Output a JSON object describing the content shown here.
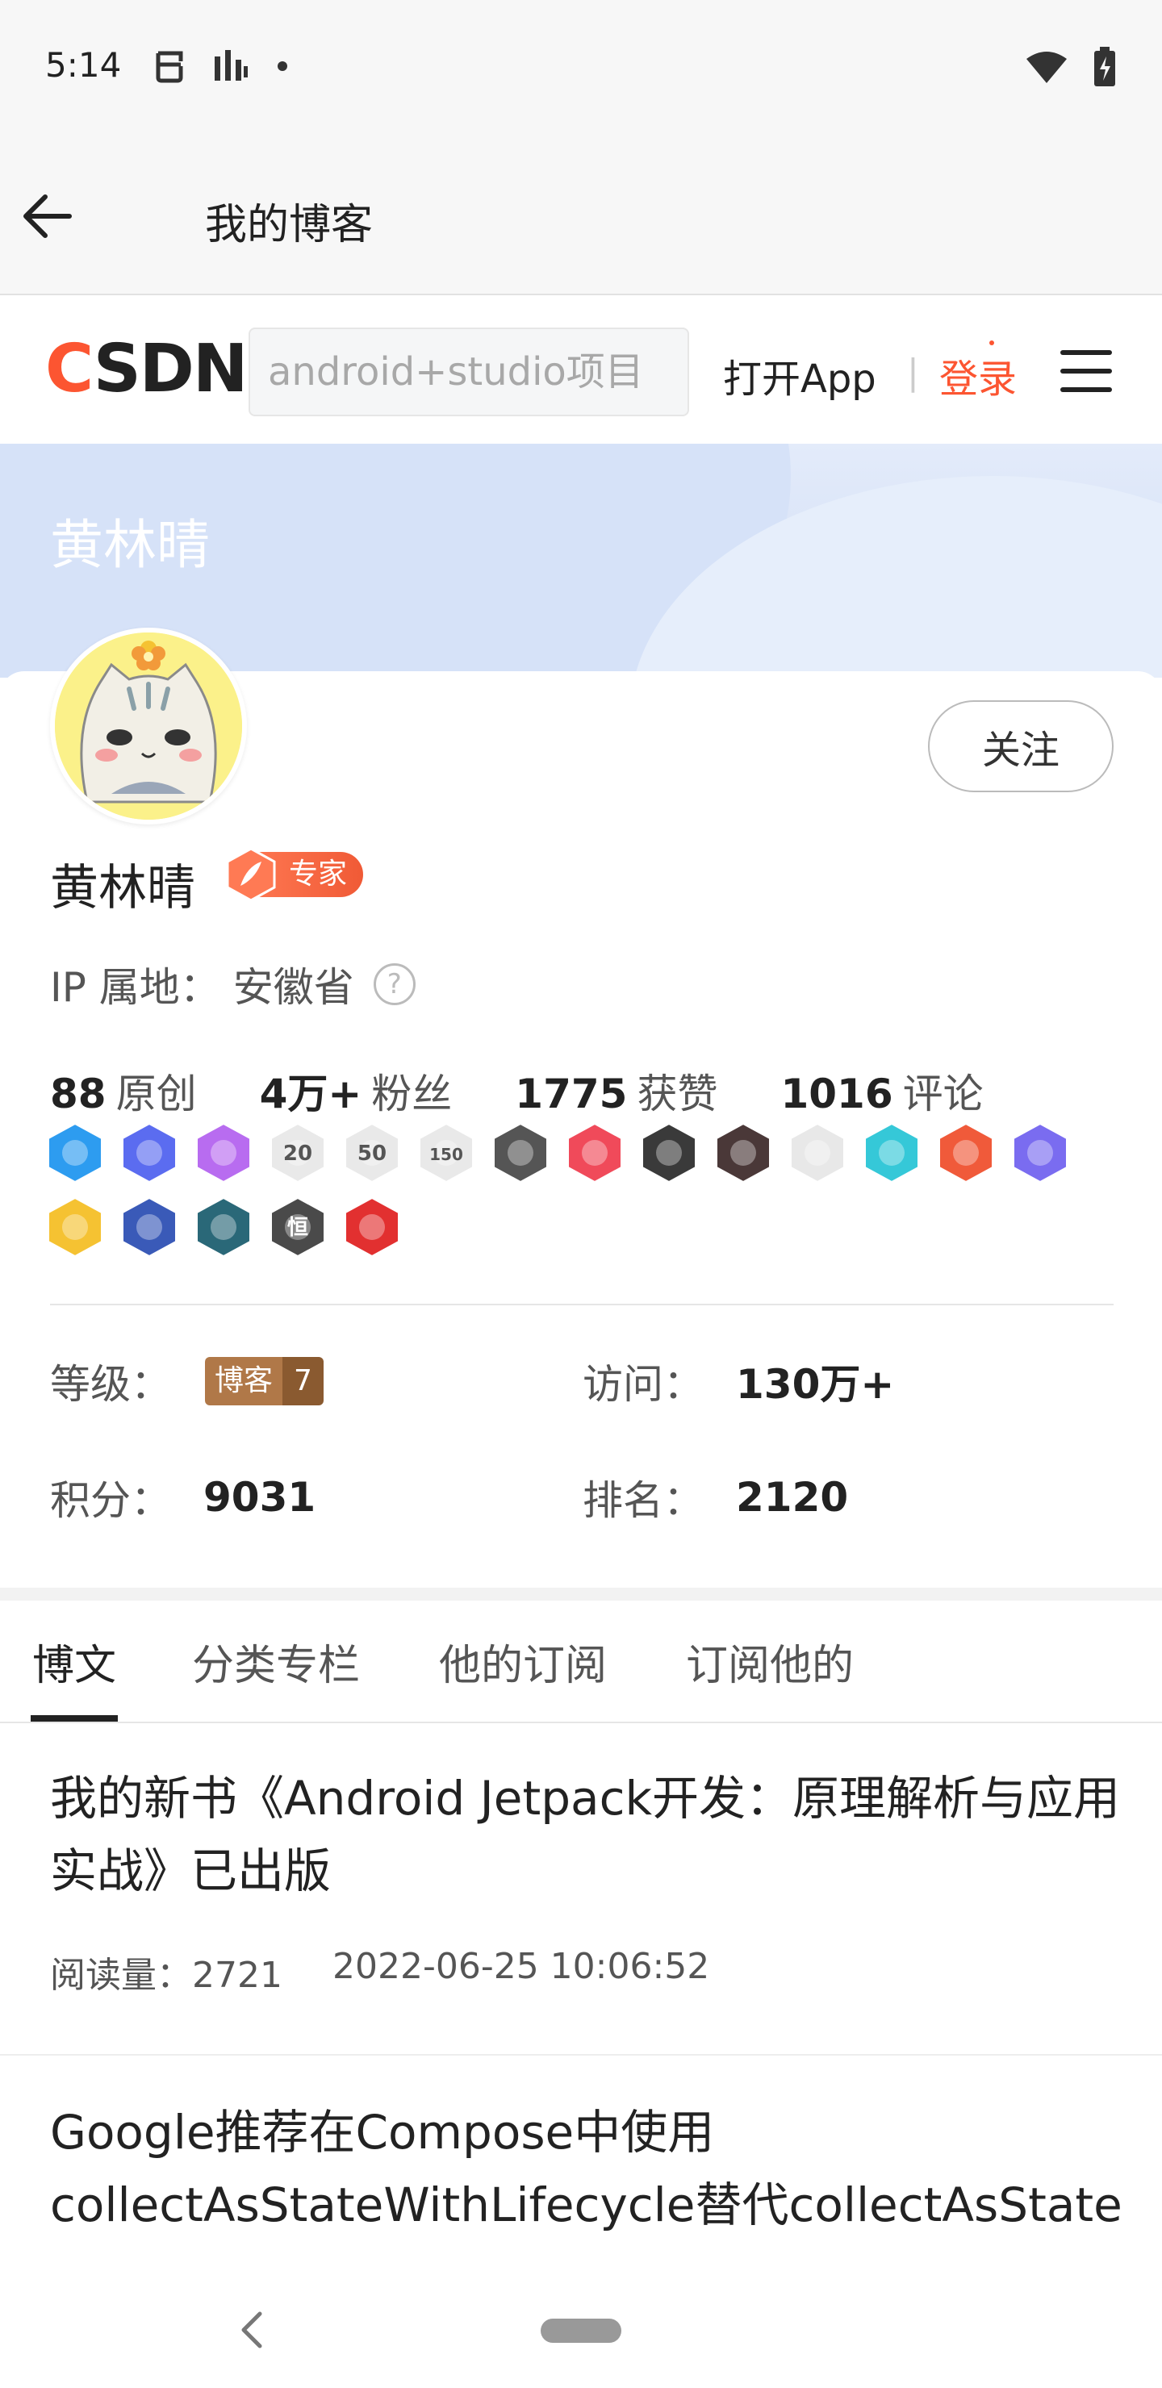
{
  "status_bar": {
    "time": "5:14",
    "left_icons": [
      "face-icon",
      "signal-bars-icon",
      "dot-icon"
    ],
    "right_icons": [
      "wifi-icon",
      "battery-charging-icon"
    ]
  },
  "app_bar": {
    "title": "我的博客",
    "back_icon": "arrow-left-icon"
  },
  "csdn_header": {
    "logo_c": "C",
    "logo_rest": "SDN",
    "search_placeholder": "android+studio项目",
    "open_app": "打开App",
    "separator": "|",
    "login": "登录",
    "menu_icon": "hamburger-menu-icon",
    "brand_color": "#fc5531"
  },
  "banner": {
    "name": "黄林晴"
  },
  "profile": {
    "follow_label": "关注",
    "name": "黄林晴",
    "expert_label": "专家",
    "ip_label": "IP 属地：",
    "ip_value": "安徽省",
    "help_glyph": "?",
    "stats": [
      {
        "num": "88",
        "label": "原创"
      },
      {
        "num": "4万+",
        "label": "粉丝"
      },
      {
        "num": "1775",
        "label": "获赞"
      },
      {
        "num": "1016",
        "label": "评论"
      }
    ],
    "badges": [
      {
        "icon": "star-badge-icon",
        "color": "#2d9cf0",
        "text": ""
      },
      {
        "icon": "planet-badge-icon",
        "color": "#5b6cf0",
        "text": ""
      },
      {
        "icon": "planet-orange-badge-icon",
        "color": "#b86cf0",
        "text": ""
      },
      {
        "icon": "days-20-badge-icon",
        "color": "#e9e9e9",
        "text": "20"
      },
      {
        "icon": "days-50-badge-icon",
        "color": "#e9e9e9",
        "text": "50"
      },
      {
        "icon": "days-150-badge-icon",
        "color": "#e9e9e9",
        "text": "150"
      },
      {
        "icon": "github-badge-icon",
        "color": "#555555",
        "text": ""
      },
      {
        "icon": "pen-red-badge-icon",
        "color": "#f04a5a",
        "text": ""
      },
      {
        "icon": "medal-1024-badge-icon",
        "color": "#3a3a3a",
        "text": ""
      },
      {
        "icon": "year-2020-badge-icon",
        "color": "#4a3838",
        "text": ""
      },
      {
        "icon": "monkey-badge-icon",
        "color": "#e8e8e8",
        "text": ""
      },
      {
        "icon": "chat-cyan-badge-icon",
        "color": "#35c8d8",
        "text": ""
      },
      {
        "icon": "gift-red-badge-icon",
        "color": "#f05a3a",
        "text": ""
      },
      {
        "icon": "hand-purple-badge-icon",
        "color": "#7a6cf0",
        "text": ""
      },
      {
        "icon": "check-yellow-badge-icon",
        "color": "#f5c232",
        "text": ""
      },
      {
        "icon": "rocket-blue-badge-icon",
        "color": "#3a5ab8",
        "text": ""
      },
      {
        "icon": "list-teal-badge-icon",
        "color": "#2a6878",
        "text": ""
      },
      {
        "icon": "heng-gray-badge-icon",
        "color": "#4a4a4a",
        "text": "恒"
      },
      {
        "icon": "pen-crimson-badge-icon",
        "color": "#e23030",
        "text": ""
      }
    ],
    "level_label": "等级：",
    "level_badge_text": "博客",
    "level_badge_num": "7",
    "visits_label": "访问：",
    "visits_value": "130万+",
    "points_label": "积分：",
    "points_value": "9031",
    "rank_label": "排名：",
    "rank_value": "2120"
  },
  "tabs": [
    {
      "label": "博文",
      "active": true
    },
    {
      "label": "分类专栏",
      "active": false
    },
    {
      "label": "他的订阅",
      "active": false
    },
    {
      "label": "订阅他的",
      "active": false
    }
  ],
  "articles": [
    {
      "title": "我的新书《Android Jetpack开发：原理解析与应用实战》已出版",
      "read_label": "阅读量：",
      "read_count": "2721",
      "date": "2022-06-25 10:06:52"
    },
    {
      "title": "Google推荐在Compose中使用collectAsStateWithLifecycle替代collectAsState",
      "read_label": "",
      "read_count": "",
      "date": ""
    }
  ],
  "nav_bar": {
    "back_icon": "nav-back-icon",
    "home_icon": "nav-home-pill-icon"
  }
}
